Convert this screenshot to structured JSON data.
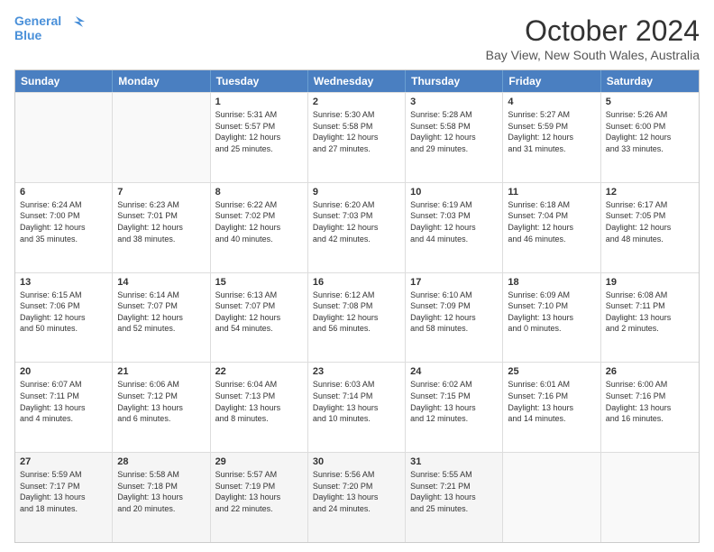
{
  "header": {
    "logo_line1": "General",
    "logo_line2": "Blue",
    "month": "October 2024",
    "location": "Bay View, New South Wales, Australia"
  },
  "weekdays": [
    "Sunday",
    "Monday",
    "Tuesday",
    "Wednesday",
    "Thursday",
    "Friday",
    "Saturday"
  ],
  "weeks": [
    [
      {
        "day": "",
        "empty": true
      },
      {
        "day": "",
        "empty": true
      },
      {
        "day": "1",
        "sunrise": "5:31 AM",
        "sunset": "5:57 PM",
        "daylight": "12 hours and 25 minutes."
      },
      {
        "day": "2",
        "sunrise": "5:30 AM",
        "sunset": "5:58 PM",
        "daylight": "12 hours and 27 minutes."
      },
      {
        "day": "3",
        "sunrise": "5:28 AM",
        "sunset": "5:58 PM",
        "daylight": "12 hours and 29 minutes."
      },
      {
        "day": "4",
        "sunrise": "5:27 AM",
        "sunset": "5:59 PM",
        "daylight": "12 hours and 31 minutes."
      },
      {
        "day": "5",
        "sunrise": "5:26 AM",
        "sunset": "6:00 PM",
        "daylight": "12 hours and 33 minutes."
      }
    ],
    [
      {
        "day": "6",
        "sunrise": "6:24 AM",
        "sunset": "7:00 PM",
        "daylight": "12 hours and 35 minutes."
      },
      {
        "day": "7",
        "sunrise": "6:23 AM",
        "sunset": "7:01 PM",
        "daylight": "12 hours and 38 minutes."
      },
      {
        "day": "8",
        "sunrise": "6:22 AM",
        "sunset": "7:02 PM",
        "daylight": "12 hours and 40 minutes."
      },
      {
        "day": "9",
        "sunrise": "6:20 AM",
        "sunset": "7:03 PM",
        "daylight": "12 hours and 42 minutes."
      },
      {
        "day": "10",
        "sunrise": "6:19 AM",
        "sunset": "7:03 PM",
        "daylight": "12 hours and 44 minutes."
      },
      {
        "day": "11",
        "sunrise": "6:18 AM",
        "sunset": "7:04 PM",
        "daylight": "12 hours and 46 minutes."
      },
      {
        "day": "12",
        "sunrise": "6:17 AM",
        "sunset": "7:05 PM",
        "daylight": "12 hours and 48 minutes."
      }
    ],
    [
      {
        "day": "13",
        "sunrise": "6:15 AM",
        "sunset": "7:06 PM",
        "daylight": "12 hours and 50 minutes."
      },
      {
        "day": "14",
        "sunrise": "6:14 AM",
        "sunset": "7:07 PM",
        "daylight": "12 hours and 52 minutes."
      },
      {
        "day": "15",
        "sunrise": "6:13 AM",
        "sunset": "7:07 PM",
        "daylight": "12 hours and 54 minutes."
      },
      {
        "day": "16",
        "sunrise": "6:12 AM",
        "sunset": "7:08 PM",
        "daylight": "12 hours and 56 minutes."
      },
      {
        "day": "17",
        "sunrise": "6:10 AM",
        "sunset": "7:09 PM",
        "daylight": "12 hours and 58 minutes."
      },
      {
        "day": "18",
        "sunrise": "6:09 AM",
        "sunset": "7:10 PM",
        "daylight": "13 hours and 0 minutes."
      },
      {
        "day": "19",
        "sunrise": "6:08 AM",
        "sunset": "7:11 PM",
        "daylight": "13 hours and 2 minutes."
      }
    ],
    [
      {
        "day": "20",
        "sunrise": "6:07 AM",
        "sunset": "7:11 PM",
        "daylight": "13 hours and 4 minutes."
      },
      {
        "day": "21",
        "sunrise": "6:06 AM",
        "sunset": "7:12 PM",
        "daylight": "13 hours and 6 minutes."
      },
      {
        "day": "22",
        "sunrise": "6:04 AM",
        "sunset": "7:13 PM",
        "daylight": "13 hours and 8 minutes."
      },
      {
        "day": "23",
        "sunrise": "6:03 AM",
        "sunset": "7:14 PM",
        "daylight": "13 hours and 10 minutes."
      },
      {
        "day": "24",
        "sunrise": "6:02 AM",
        "sunset": "7:15 PM",
        "daylight": "13 hours and 12 minutes."
      },
      {
        "day": "25",
        "sunrise": "6:01 AM",
        "sunset": "7:16 PM",
        "daylight": "13 hours and 14 minutes."
      },
      {
        "day": "26",
        "sunrise": "6:00 AM",
        "sunset": "7:16 PM",
        "daylight": "13 hours and 16 minutes."
      }
    ],
    [
      {
        "day": "27",
        "sunrise": "5:59 AM",
        "sunset": "7:17 PM",
        "daylight": "13 hours and 18 minutes."
      },
      {
        "day": "28",
        "sunrise": "5:58 AM",
        "sunset": "7:18 PM",
        "daylight": "13 hours and 20 minutes."
      },
      {
        "day": "29",
        "sunrise": "5:57 AM",
        "sunset": "7:19 PM",
        "daylight": "13 hours and 22 minutes."
      },
      {
        "day": "30",
        "sunrise": "5:56 AM",
        "sunset": "7:20 PM",
        "daylight": "13 hours and 24 minutes."
      },
      {
        "day": "31",
        "sunrise": "5:55 AM",
        "sunset": "7:21 PM",
        "daylight": "13 hours and 25 minutes."
      },
      {
        "day": "",
        "empty": true
      },
      {
        "day": "",
        "empty": true
      }
    ]
  ]
}
